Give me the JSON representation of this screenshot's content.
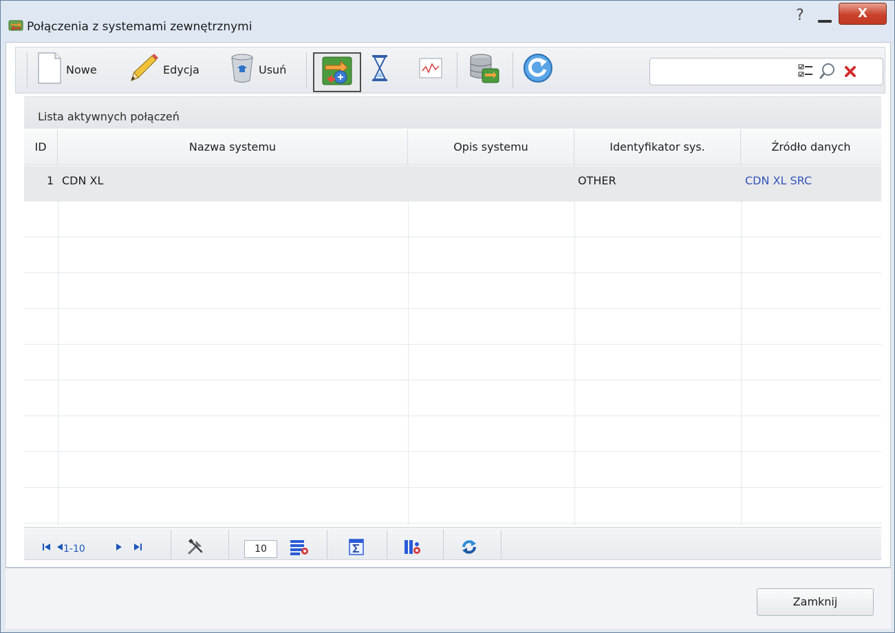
{
  "window": {
    "title": "Połączenia z systemami zewnętrznymi",
    "help_symbol": "?",
    "close_symbol": "X"
  },
  "toolbar": {
    "new_label": "Nowe",
    "edit_label": "Edycja",
    "delete_label": "Usuń",
    "icons": [
      "new-document-icon",
      "pencil-icon",
      "recycle-bin-icon",
      "sync-connection-icon",
      "hourglass-icon",
      "chart-icon",
      "database-sync-icon",
      "refresh-icon"
    ]
  },
  "search": {
    "value": "",
    "icons": [
      "filter-checklist-icon",
      "magnifier-icon",
      "clear-x-icon"
    ]
  },
  "grid": {
    "title": "Lista aktywnych połączeń",
    "columns": [
      "ID",
      "Nazwa systemu",
      "Opis systemu",
      "Identyfikator sys.",
      "Źródło danych"
    ],
    "rows": [
      {
        "id": "1",
        "name": "CDN XL",
        "description": "",
        "identifier": "OTHER",
        "source": "CDN XL SRC"
      }
    ]
  },
  "pager": {
    "range_text": "1-10",
    "page_size": "10"
  },
  "footer": {
    "close_label": "Zamknij"
  },
  "colors": {
    "accent_link": "#3355bb",
    "close_button": "#c9412b",
    "pager_text": "#1a56b8"
  }
}
